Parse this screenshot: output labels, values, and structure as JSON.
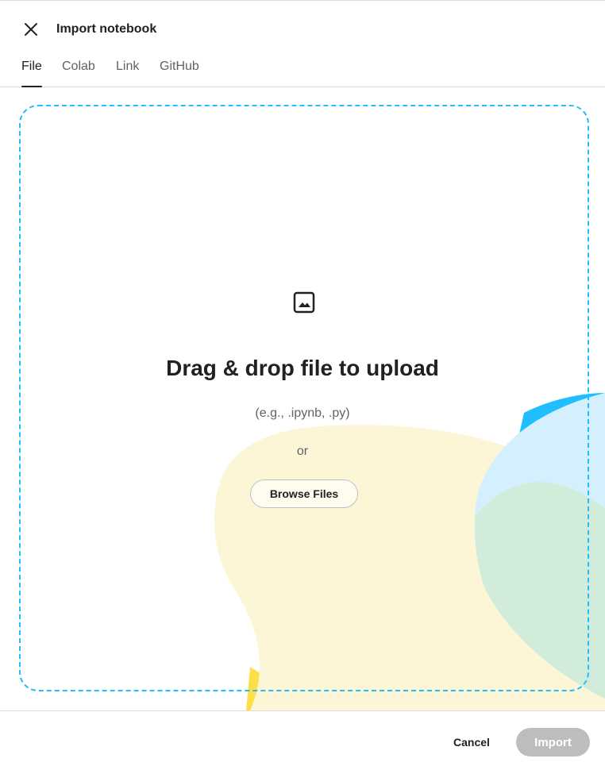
{
  "dialog": {
    "title": "Import notebook",
    "close_icon": "close-icon"
  },
  "tabs": [
    {
      "label": "File",
      "active": true
    },
    {
      "label": "Colab",
      "active": false
    },
    {
      "label": "Link",
      "active": false
    },
    {
      "label": "GitHub",
      "active": false
    }
  ],
  "dropzone": {
    "icon": "image-icon",
    "title": "Drag & drop file to upload",
    "hint": "(e.g., .ipynb, .py)",
    "or": "or",
    "browse_label": "Browse Files"
  },
  "footer": {
    "cancel_label": "Cancel",
    "import_label": "Import",
    "import_enabled": false
  },
  "colors": {
    "dropzone_border": "#20beff",
    "blob_yellow": "#fdf6d6",
    "blob_yellow_strong": "#fddf47",
    "blob_blue_light": "#d4effd",
    "blob_blue": "#20beff",
    "blob_green_light": "#d2ecdc",
    "blob_green": "#21a345",
    "import_disabled": "#bdbdbd"
  }
}
